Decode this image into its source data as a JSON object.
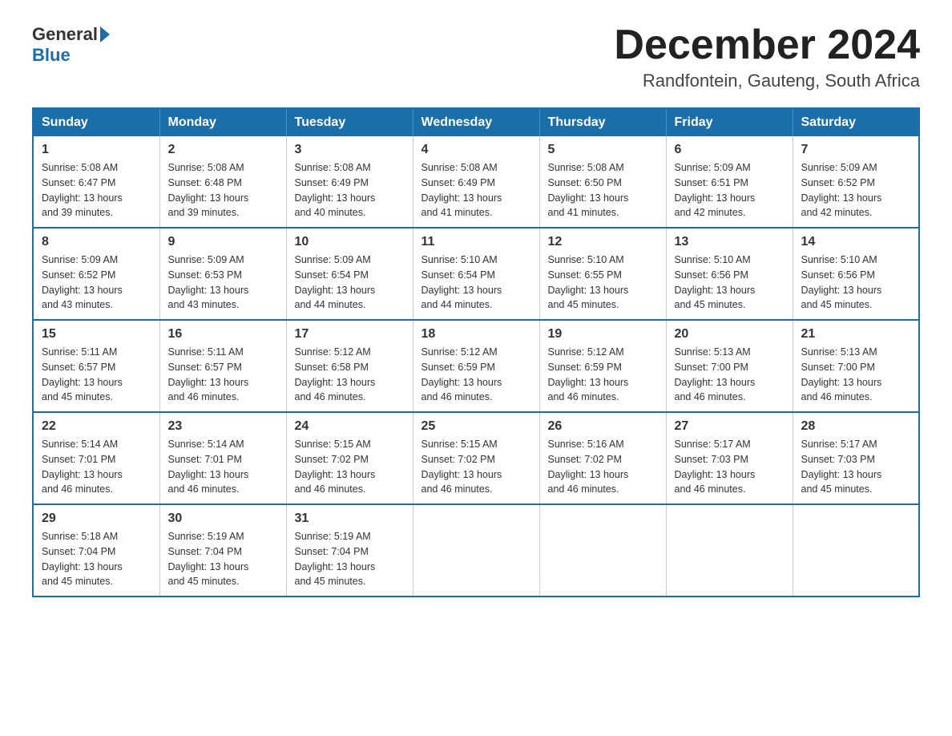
{
  "logo": {
    "general": "General",
    "blue": "Blue"
  },
  "title": {
    "month": "December 2024",
    "location": "Randfontein, Gauteng, South Africa"
  },
  "days_of_week": [
    "Sunday",
    "Monday",
    "Tuesday",
    "Wednesday",
    "Thursday",
    "Friday",
    "Saturday"
  ],
  "weeks": [
    [
      {
        "day": "1",
        "sunrise": "5:08 AM",
        "sunset": "6:47 PM",
        "daylight": "13 hours and 39 minutes."
      },
      {
        "day": "2",
        "sunrise": "5:08 AM",
        "sunset": "6:48 PM",
        "daylight": "13 hours and 39 minutes."
      },
      {
        "day": "3",
        "sunrise": "5:08 AM",
        "sunset": "6:49 PM",
        "daylight": "13 hours and 40 minutes."
      },
      {
        "day": "4",
        "sunrise": "5:08 AM",
        "sunset": "6:49 PM",
        "daylight": "13 hours and 41 minutes."
      },
      {
        "day": "5",
        "sunrise": "5:08 AM",
        "sunset": "6:50 PM",
        "daylight": "13 hours and 41 minutes."
      },
      {
        "day": "6",
        "sunrise": "5:09 AM",
        "sunset": "6:51 PM",
        "daylight": "13 hours and 42 minutes."
      },
      {
        "day": "7",
        "sunrise": "5:09 AM",
        "sunset": "6:52 PM",
        "daylight": "13 hours and 42 minutes."
      }
    ],
    [
      {
        "day": "8",
        "sunrise": "5:09 AM",
        "sunset": "6:52 PM",
        "daylight": "13 hours and 43 minutes."
      },
      {
        "day": "9",
        "sunrise": "5:09 AM",
        "sunset": "6:53 PM",
        "daylight": "13 hours and 43 minutes."
      },
      {
        "day": "10",
        "sunrise": "5:09 AM",
        "sunset": "6:54 PM",
        "daylight": "13 hours and 44 minutes."
      },
      {
        "day": "11",
        "sunrise": "5:10 AM",
        "sunset": "6:54 PM",
        "daylight": "13 hours and 44 minutes."
      },
      {
        "day": "12",
        "sunrise": "5:10 AM",
        "sunset": "6:55 PM",
        "daylight": "13 hours and 45 minutes."
      },
      {
        "day": "13",
        "sunrise": "5:10 AM",
        "sunset": "6:56 PM",
        "daylight": "13 hours and 45 minutes."
      },
      {
        "day": "14",
        "sunrise": "5:10 AM",
        "sunset": "6:56 PM",
        "daylight": "13 hours and 45 minutes."
      }
    ],
    [
      {
        "day": "15",
        "sunrise": "5:11 AM",
        "sunset": "6:57 PM",
        "daylight": "13 hours and 45 minutes."
      },
      {
        "day": "16",
        "sunrise": "5:11 AM",
        "sunset": "6:57 PM",
        "daylight": "13 hours and 46 minutes."
      },
      {
        "day": "17",
        "sunrise": "5:12 AM",
        "sunset": "6:58 PM",
        "daylight": "13 hours and 46 minutes."
      },
      {
        "day": "18",
        "sunrise": "5:12 AM",
        "sunset": "6:59 PM",
        "daylight": "13 hours and 46 minutes."
      },
      {
        "day": "19",
        "sunrise": "5:12 AM",
        "sunset": "6:59 PM",
        "daylight": "13 hours and 46 minutes."
      },
      {
        "day": "20",
        "sunrise": "5:13 AM",
        "sunset": "7:00 PM",
        "daylight": "13 hours and 46 minutes."
      },
      {
        "day": "21",
        "sunrise": "5:13 AM",
        "sunset": "7:00 PM",
        "daylight": "13 hours and 46 minutes."
      }
    ],
    [
      {
        "day": "22",
        "sunrise": "5:14 AM",
        "sunset": "7:01 PM",
        "daylight": "13 hours and 46 minutes."
      },
      {
        "day": "23",
        "sunrise": "5:14 AM",
        "sunset": "7:01 PM",
        "daylight": "13 hours and 46 minutes."
      },
      {
        "day": "24",
        "sunrise": "5:15 AM",
        "sunset": "7:02 PM",
        "daylight": "13 hours and 46 minutes."
      },
      {
        "day": "25",
        "sunrise": "5:15 AM",
        "sunset": "7:02 PM",
        "daylight": "13 hours and 46 minutes."
      },
      {
        "day": "26",
        "sunrise": "5:16 AM",
        "sunset": "7:02 PM",
        "daylight": "13 hours and 46 minutes."
      },
      {
        "day": "27",
        "sunrise": "5:17 AM",
        "sunset": "7:03 PM",
        "daylight": "13 hours and 46 minutes."
      },
      {
        "day": "28",
        "sunrise": "5:17 AM",
        "sunset": "7:03 PM",
        "daylight": "13 hours and 45 minutes."
      }
    ],
    [
      {
        "day": "29",
        "sunrise": "5:18 AM",
        "sunset": "7:04 PM",
        "daylight": "13 hours and 45 minutes."
      },
      {
        "day": "30",
        "sunrise": "5:19 AM",
        "sunset": "7:04 PM",
        "daylight": "13 hours and 45 minutes."
      },
      {
        "day": "31",
        "sunrise": "5:19 AM",
        "sunset": "7:04 PM",
        "daylight": "13 hours and 45 minutes."
      },
      null,
      null,
      null,
      null
    ]
  ],
  "labels": {
    "sunrise": "Sunrise:",
    "sunset": "Sunset:",
    "daylight": "Daylight:"
  }
}
